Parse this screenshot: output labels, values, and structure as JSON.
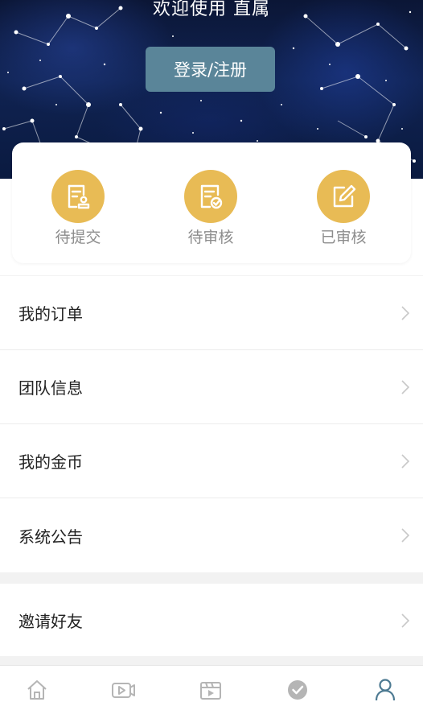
{
  "header": {
    "welcome": "欢迎使用 直属",
    "login_label": "登录/注册"
  },
  "status": [
    {
      "label": "待提交",
      "icon": "document-stamp-icon"
    },
    {
      "label": "待审核",
      "icon": "document-check-icon"
    },
    {
      "label": "已审核",
      "icon": "edit-icon"
    }
  ],
  "menu1": [
    {
      "label": "我的订单"
    },
    {
      "label": "团队信息"
    },
    {
      "label": "我的金币"
    },
    {
      "label": "系统公告"
    }
  ],
  "menu2": [
    {
      "label": "邀请好友"
    }
  ],
  "tabbar": {
    "items": [
      "home-icon",
      "video-icon",
      "clapperboard-icon",
      "check-circle-icon",
      "user-icon"
    ],
    "active_index": 4
  },
  "colors": {
    "accent_gold": "#e8bb55",
    "login_button": "#5a8599",
    "active_tab": "#4d7a92"
  }
}
